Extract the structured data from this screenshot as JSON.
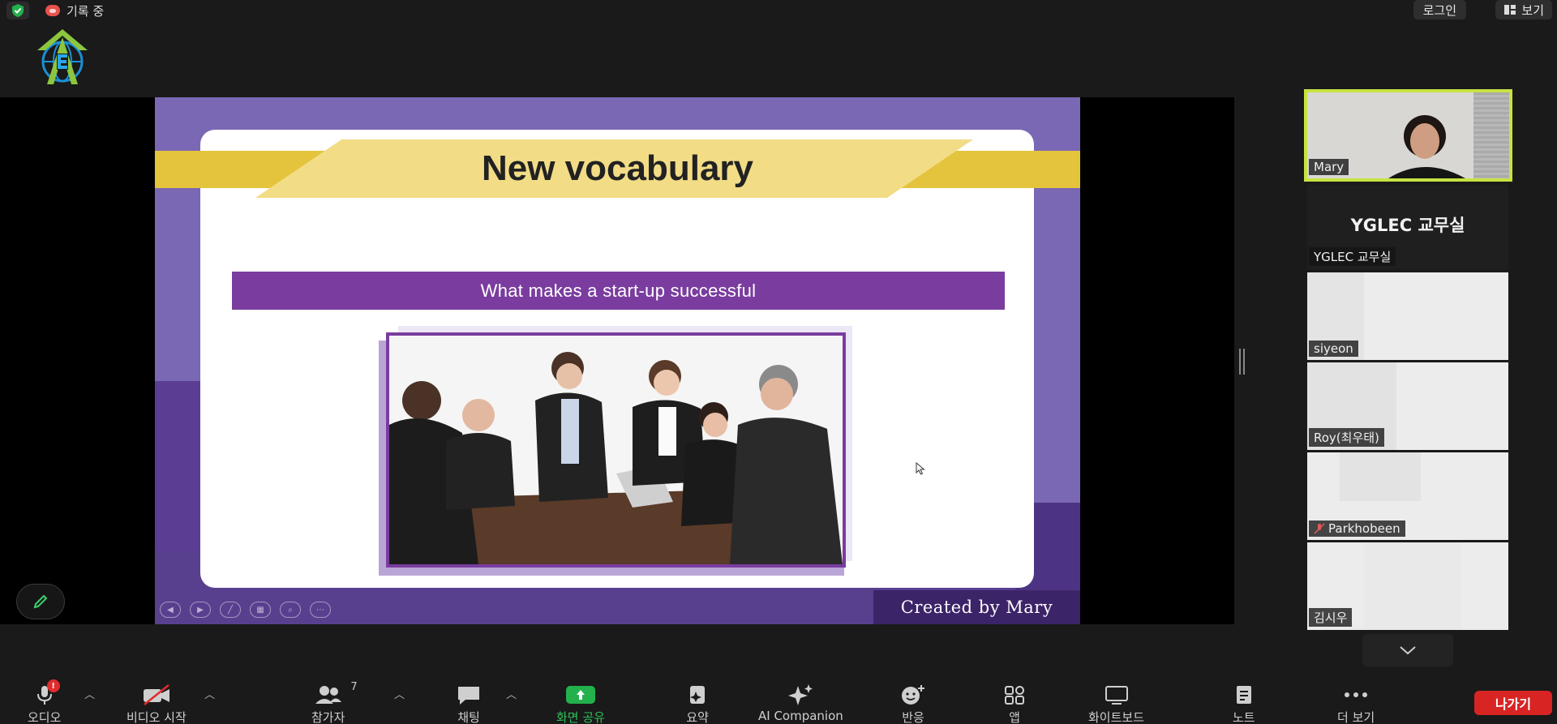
{
  "topbar": {
    "recording_label": "기록 중",
    "login_label": "로그인",
    "view_label": "보기"
  },
  "slide": {
    "title": "New vocabulary",
    "subtitle": "What makes a start-up successful",
    "credit": "Created by Mary"
  },
  "participants": [
    {
      "name": "Mary",
      "video": true,
      "active": true
    },
    {
      "name": "YGLEC 교무실",
      "display_name": "YGLEC 교무실",
      "video": false
    },
    {
      "name": "siyeon",
      "video": true
    },
    {
      "name": "Roy(최우태)",
      "video": true
    },
    {
      "name": "Parkhobeen",
      "video": true,
      "muted": true
    },
    {
      "name": "김시우",
      "video": true
    }
  ],
  "toolbar": {
    "audio_label": "오디오",
    "audio_badge": "!",
    "video_label": "비디오 시작",
    "participants_label": "참가자",
    "participants_count": "7",
    "chat_label": "채팅",
    "share_label": "화면 공유",
    "summary_label": "요약",
    "ai_label": "AI Companion",
    "reactions_label": "반응",
    "apps_label": "앱",
    "whiteboard_label": "화이트보드",
    "notes_label": "노트",
    "more_label": "더 보기",
    "leave_label": "나가기"
  },
  "colors": {
    "accent_green": "#23b14d",
    "active_speaker_border": "#c6e341",
    "leave_red": "#d92424",
    "slide_purple": "#7a68b4",
    "ribbon_yellow": "#e4c43c"
  }
}
